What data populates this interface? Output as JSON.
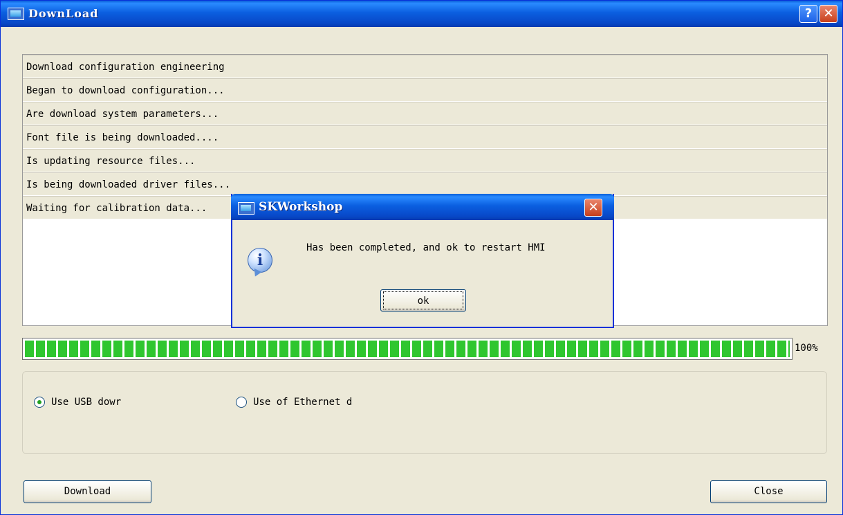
{
  "window": {
    "title": "DownLoad",
    "help_label": "?",
    "close_label": "✕"
  },
  "log": {
    "rows": [
      "Download configuration engineering",
      "Began to download configuration...",
      "Are download system parameters...",
      "Font file is being downloaded....",
      "Is updating resource files...",
      "Is being downloaded driver files...",
      "Waiting for calibration data..."
    ]
  },
  "progress": {
    "value": 1.0,
    "label": "100%"
  },
  "options": {
    "usb_label": "Use USB dowr",
    "ethernet_label": "Use of Ethernet d",
    "selected": "usb"
  },
  "buttons": {
    "download_label": "Download",
    "close_label": "Close"
  },
  "dialog": {
    "title": "SKWorkshop",
    "close_label": "✕",
    "icon": "info-icon",
    "message": "Has been completed, and ok to restart HMI",
    "ok_label": "ok"
  },
  "colors": {
    "titlebar": "#0b5fe0",
    "progress_fill": "#2fc62f",
    "window_bg": "#ece9d8"
  }
}
